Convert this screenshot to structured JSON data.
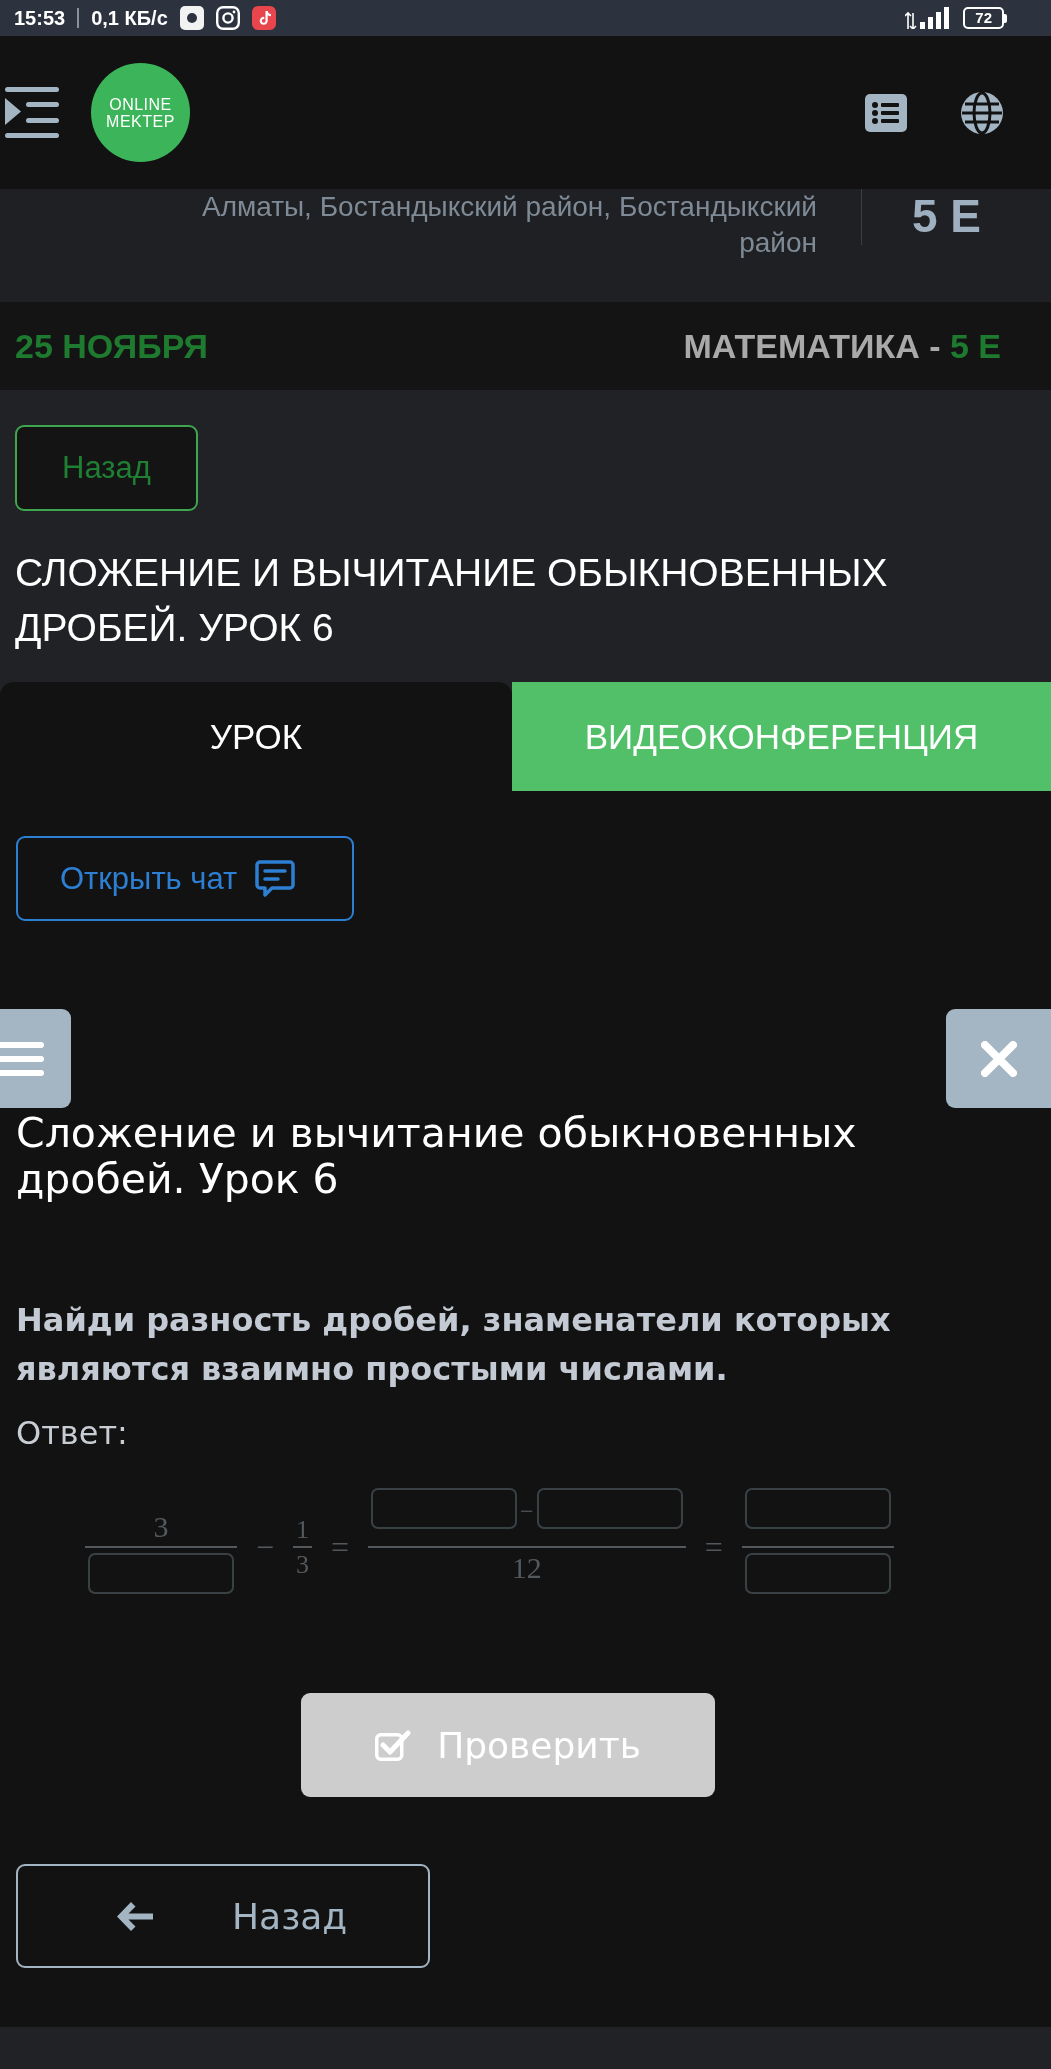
{
  "status_bar": {
    "time": "15:53",
    "network_speed": "0,1 КБ/с",
    "battery": "72"
  },
  "header": {
    "logo_lines": [
      "ONLINE",
      "MEKTEP"
    ]
  },
  "school": {
    "location": "Алматы, Бостандыкский район, Бостандыкский район",
    "class_name": "5 Е"
  },
  "lesson_bar": {
    "date": "25 НОЯБРЯ",
    "subject": "МАТЕМАТИКА -",
    "class_name": "5 Е"
  },
  "back_button": {
    "label": "Назад"
  },
  "lesson_title": "СЛОЖЕНИЕ И ВЫЧИТАНИЕ ОБЫКНОВЕННЫХ ДРОБЕЙ. УРОК 6",
  "tabs": [
    {
      "label": "УРОК",
      "selected": true
    },
    {
      "label": "ВИДЕОКОНФЕРЕНЦИЯ",
      "selected": false
    }
  ],
  "chat_button": {
    "label": "Открыть чат"
  },
  "task": {
    "title": "Сложение и вычитание обыкновенных дробей. Урок 6",
    "question": "Найди разность дробей, знаменатели которых являются взаимно простыми числами.",
    "answer_label": "Ответ:",
    "equation": [
      {
        "kind": "fraction",
        "numerator": [
          {
            "kind": "number",
            "text": "3"
          }
        ],
        "denominator": [
          {
            "kind": "blank"
          }
        ]
      },
      {
        "kind": "operator",
        "text": "−"
      },
      {
        "kind": "small_fraction",
        "numerator": [
          {
            "kind": "number",
            "text": "1"
          }
        ],
        "denominator": [
          {
            "kind": "number",
            "text": "3"
          }
        ]
      },
      {
        "kind": "operator",
        "text": "="
      },
      {
        "kind": "fraction",
        "numerator": [
          {
            "kind": "blank"
          },
          {
            "kind": "operator",
            "text": "−"
          },
          {
            "kind": "blank"
          }
        ],
        "denominator": [
          {
            "kind": "number",
            "text": "12"
          }
        ]
      },
      {
        "kind": "operator",
        "text": "="
      },
      {
        "kind": "fraction",
        "numerator": [
          {
            "kind": "blank"
          }
        ],
        "denominator": [
          {
            "kind": "blank"
          }
        ]
      }
    ],
    "check_button": {
      "label": "Проверить",
      "disabled": true
    },
    "back_button": {
      "label": "Назад"
    }
  }
}
